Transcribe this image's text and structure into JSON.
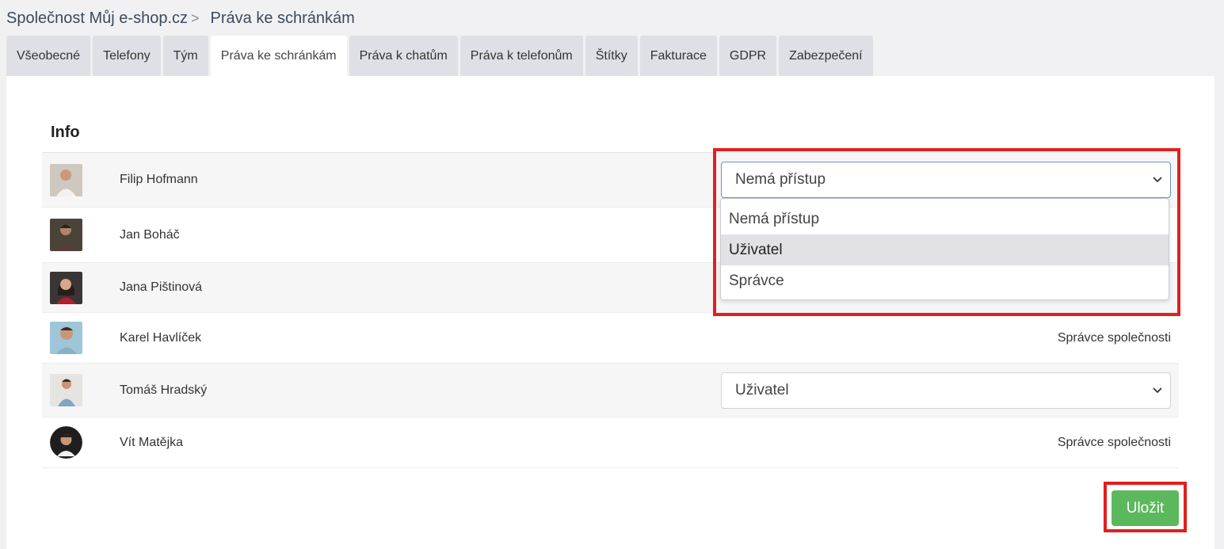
{
  "breadcrumb": {
    "company": "Společnost Můj e-shop.cz",
    "separator": ">",
    "current": "Práva ke schránkám"
  },
  "tabs": [
    {
      "label": "Všeobecné",
      "active": false
    },
    {
      "label": "Telefony",
      "active": false
    },
    {
      "label": "Tým",
      "active": false
    },
    {
      "label": "Práva ke schránkám",
      "active": true
    },
    {
      "label": "Práva k chatům",
      "active": false
    },
    {
      "label": "Práva k telefonům",
      "active": false
    },
    {
      "label": "Štítky",
      "active": false
    },
    {
      "label": "Fakturace",
      "active": false
    },
    {
      "label": "GDPR",
      "active": false
    },
    {
      "label": "Zabezpečení",
      "active": false
    }
  ],
  "section": {
    "title": "Info"
  },
  "users": [
    {
      "name": "Filip Hofmann",
      "role_type": "select",
      "value": "Nemá přístup"
    },
    {
      "name": "Jan Boháč",
      "role_type": "hidden"
    },
    {
      "name": "Jana Pištinová",
      "role_type": "hidden"
    },
    {
      "name": "Karel Havlíček",
      "role_type": "text",
      "value": "Správce společnosti"
    },
    {
      "name": "Tomáš Hradský",
      "role_type": "select",
      "value": "Uživatel"
    },
    {
      "name": "Vít Matějka",
      "role_type": "text",
      "value": "Správce společnosti"
    }
  ],
  "dropdown": {
    "options": [
      "Nemá přístup",
      "Uživatel",
      "Správce"
    ],
    "hovered": "Uživatel"
  },
  "actions": {
    "save_label": "Uložit"
  },
  "colors": {
    "save_button": "#5cb85c",
    "highlight": "#e0201f",
    "tab_inactive": "#dfe0e5",
    "hover_option": "#e2e2e6"
  },
  "icons": {
    "select_arrow": "chevron-down-icon"
  }
}
